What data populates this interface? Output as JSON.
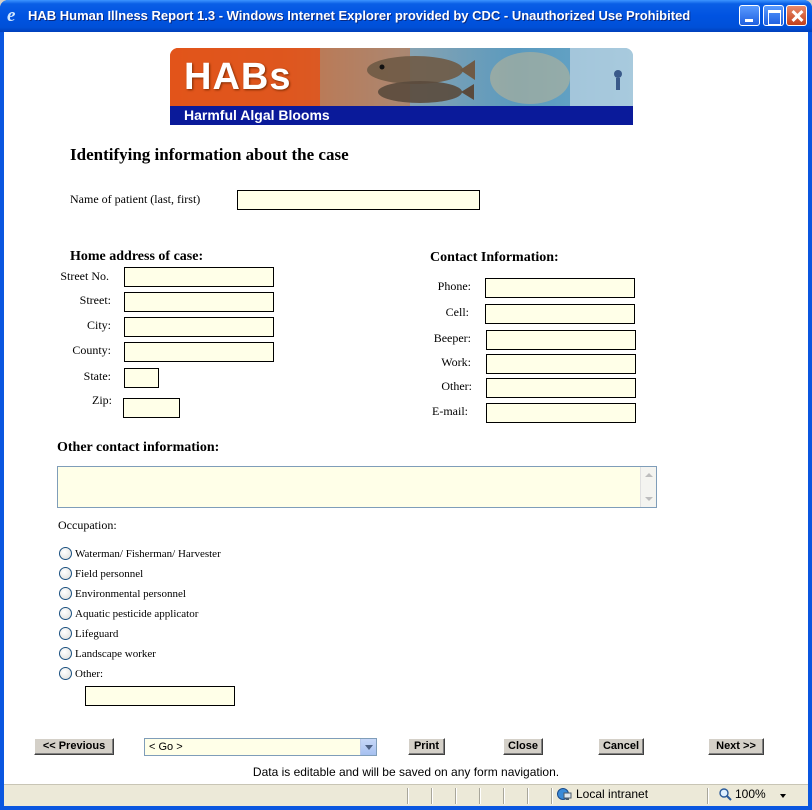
{
  "window": {
    "title": "HAB Human Illness Report 1.3 - Windows Internet Explorer provided by CDC - Unauthorized Use Prohibited",
    "app_icon": "ie-icon"
  },
  "banner": {
    "logo": "HABs",
    "subtitle": "Harmful Algal Blooms"
  },
  "form": {
    "heading": "Identifying information about the case",
    "patient_name_label": "Name of patient (last, first)",
    "patient_name_value": "",
    "home_address": {
      "heading": "Home address of case:",
      "street_no": "Street No.",
      "street": "Street:",
      "city": "City:",
      "county": "County:",
      "state": "State:",
      "zip": "Zip:"
    },
    "contact": {
      "heading": "Contact Information:",
      "phone": "Phone:",
      "cell": "Cell:",
      "beeper": "Beeper:",
      "work": "Work:",
      "other": "Other:",
      "email": "E-mail:"
    },
    "other_contact_heading": "Other contact information:",
    "occupation_label": "Occupation:",
    "occupations": [
      "Waterman/ Fisherman/ Harvester",
      "Field personnel",
      "Environmental personnel",
      "Aquatic pesticide applicator",
      "Lifeguard",
      "Landscape worker",
      "Other:"
    ],
    "input_bg": "#ffffe8"
  },
  "nav": {
    "previous": "<< Previous",
    "go_select": "< Go >",
    "print": "Print",
    "close": "Close",
    "cancel": "Cancel",
    "next": "Next >>",
    "note": "Data is editable and will be saved on any form navigation."
  },
  "status": {
    "zone": "Local intranet",
    "zoom": "100%"
  }
}
